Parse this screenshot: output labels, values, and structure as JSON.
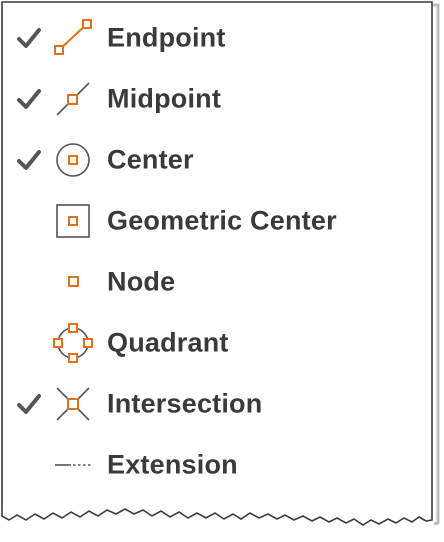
{
  "colors": {
    "accent": "#e0701b",
    "text": "#3a3a3a",
    "icon_stroke": "#555555",
    "check": "#555555"
  },
  "menu": {
    "items": [
      {
        "label": "Endpoint",
        "checked": true,
        "icon": "endpoint-icon"
      },
      {
        "label": "Midpoint",
        "checked": true,
        "icon": "midpoint-icon"
      },
      {
        "label": "Center",
        "checked": true,
        "icon": "center-icon"
      },
      {
        "label": "Geometric Center",
        "checked": false,
        "icon": "geometric-center-icon"
      },
      {
        "label": "Node",
        "checked": false,
        "icon": "node-icon"
      },
      {
        "label": "Quadrant",
        "checked": false,
        "icon": "quadrant-icon"
      },
      {
        "label": "Intersection",
        "checked": true,
        "icon": "intersection-icon"
      },
      {
        "label": "Extension",
        "checked": false,
        "icon": "extension-icon"
      }
    ]
  }
}
